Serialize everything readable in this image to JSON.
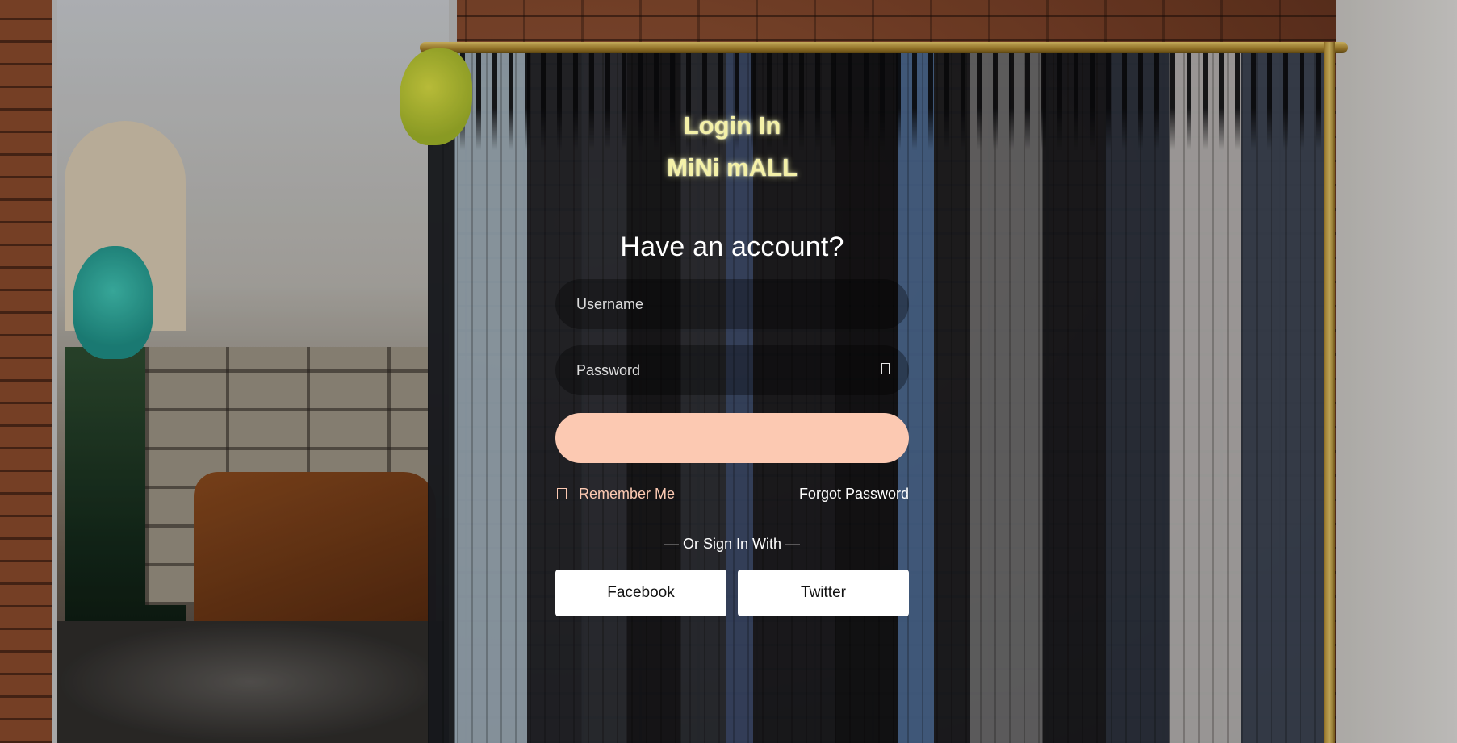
{
  "brand": {
    "line1": "Login In",
    "line2": "MiNi mALL"
  },
  "form": {
    "heading": "Have an account?",
    "username_placeholder": "Username",
    "password_placeholder": "Password",
    "password_toggle_icon": "eye-icon",
    "submit_label": "",
    "remember_label": "Remember Me",
    "remember_checked": false,
    "forgot_label": "Forgot Password",
    "divider_text": "— Or Sign In With —",
    "social": {
      "facebook_label": "Facebook",
      "twitter_label": "Twitter"
    }
  },
  "colors": {
    "brand_text": "#f4f1a8",
    "accent": "#fcc9b2",
    "field_bg": "rgba(0,0,0,0.32)",
    "social_button_bg": "#ffffff"
  }
}
